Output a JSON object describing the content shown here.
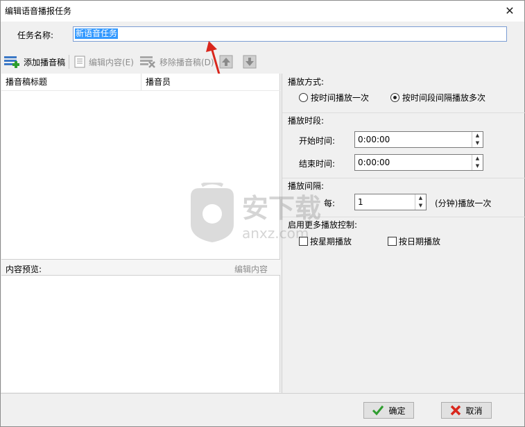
{
  "window": {
    "title": "编辑语音播报任务"
  },
  "task_name": {
    "label": "任务名称:",
    "value": "新语音任务"
  },
  "toolbar": {
    "add": "添加播音稿",
    "edit": "编辑内容(E)",
    "remove": "移除播音稿(D)"
  },
  "list": {
    "col_title": "播音稿标题",
    "col_announcer": "播音员"
  },
  "preview": {
    "label": "内容预览:",
    "edit": "编辑内容"
  },
  "play_mode": {
    "title": "播放方式:",
    "option_once": "按时间播放一次",
    "option_repeat": "按时间段间隔播放多次"
  },
  "period": {
    "title": "播放时段:",
    "start_label": "开始时间:",
    "start_value": "0:00:00",
    "end_label": "结束时间:",
    "end_value": "0:00:00"
  },
  "interval": {
    "title": "播放间隔:",
    "every_label": "每:",
    "value": "1",
    "unit": "(分钟)播放一次"
  },
  "more": {
    "title": "启用更多播放控制:",
    "by_week": "按星期播放",
    "by_date": "按日期播放"
  },
  "buttons": {
    "ok": "确定",
    "cancel": "取消"
  },
  "watermark": {
    "text_cn": "安下载",
    "text_en": "anxz.com"
  },
  "colors": {
    "accent_red": "#d9261c",
    "selection_blue": "#3399ff",
    "ok_green": "#2e9d2e"
  }
}
